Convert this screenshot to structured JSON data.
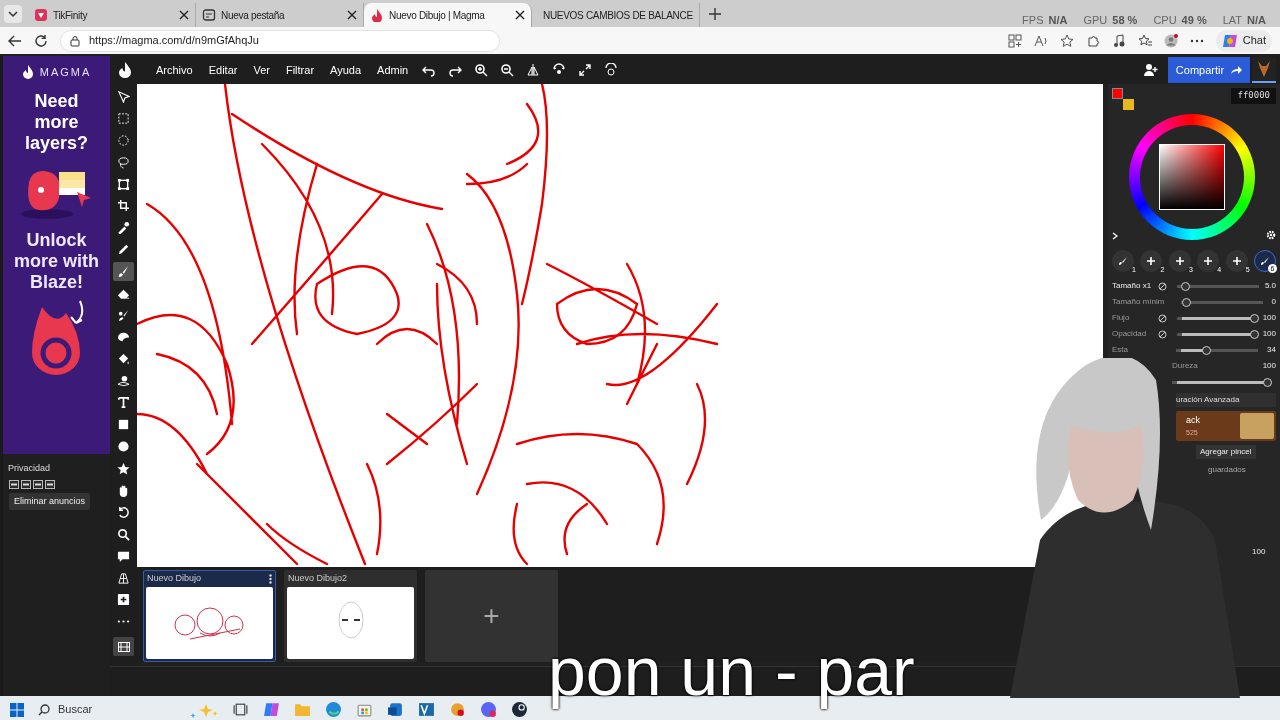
{
  "browser": {
    "tabs": [
      {
        "title": "TikFinity",
        "selected": false
      },
      {
        "title": "Nueva pestaña",
        "selected": false
      },
      {
        "title": "Nuevo Dibujo | Magma",
        "selected": true
      },
      {
        "title": "NUEVOS CAMBIOS DE BALANCE",
        "selected": false
      }
    ],
    "url": "https://magma.com/d/n9mGfAhqJu",
    "chat_button": "Chat"
  },
  "perf_overlay": [
    {
      "label": "FPS",
      "value": "N/A"
    },
    {
      "label": "GPU",
      "value": "58 %"
    },
    {
      "label": "CPU",
      "value": "49 %"
    },
    {
      "label": "LAT",
      "value": "N/A"
    }
  ],
  "ad": {
    "brand": "MAGMA",
    "headline": "Need more layers?",
    "tagline": "Unlock more with Blaze!",
    "privacy": "Privacidad",
    "remove_ads": "Eliminar anuncios"
  },
  "menu": [
    "Archivo",
    "Editar",
    "Ver",
    "Filtrar",
    "Ayuda",
    "Admin"
  ],
  "share_button": "Compartir",
  "tools": [
    {
      "kind": "move",
      "selected": false
    },
    {
      "kind": "rect-select",
      "selected": false
    },
    {
      "kind": "ellipse-select",
      "selected": false
    },
    {
      "kind": "lasso",
      "selected": false
    },
    {
      "kind": "transform",
      "selected": false
    },
    {
      "kind": "crop",
      "selected": false
    },
    {
      "kind": "eyedropper",
      "selected": false
    },
    {
      "kind": "pencil",
      "selected": false
    },
    {
      "kind": "brush",
      "selected": true
    },
    {
      "kind": "eraser",
      "selected": false
    },
    {
      "kind": "smudge",
      "selected": false
    },
    {
      "kind": "blur",
      "selected": false
    },
    {
      "kind": "fill",
      "selected": false
    },
    {
      "kind": "shape-brush",
      "selected": false
    },
    {
      "kind": "text",
      "selected": false
    },
    {
      "kind": "rect",
      "selected": false
    },
    {
      "kind": "ellipse",
      "selected": false
    },
    {
      "kind": "star",
      "selected": false
    },
    {
      "kind": "hand",
      "selected": false
    },
    {
      "kind": "rotate",
      "selected": false
    },
    {
      "kind": "zoom",
      "selected": false
    },
    {
      "kind": "comment",
      "selected": false
    },
    {
      "kind": "perspective",
      "selected": false
    },
    {
      "kind": "add",
      "selected": false
    },
    {
      "kind": "more",
      "selected": false
    }
  ],
  "color": {
    "hex": "ff0000"
  },
  "brush_slots": [
    {
      "label": "1",
      "kind": "brush",
      "selected": false
    },
    {
      "label": "2",
      "kind": "empty",
      "selected": false
    },
    {
      "label": "3",
      "kind": "empty",
      "selected": false
    },
    {
      "label": "4",
      "kind": "empty",
      "selected": false
    },
    {
      "label": "5",
      "kind": "empty",
      "selected": false
    },
    {
      "label": "6",
      "kind": "brush",
      "selected": true
    }
  ],
  "brush_settings": [
    {
      "label": "Tamaño x1",
      "pressure": true,
      "level": 0.05,
      "reading": "5.0"
    },
    {
      "label": "Tamaño mínim",
      "pressure": false,
      "level": 0,
      "reading": "0"
    },
    {
      "label": "Flujo",
      "pressure": true,
      "level": 1,
      "reading": "100"
    },
    {
      "label": "Opacidad",
      "pressure": true,
      "level": 1,
      "reading": "100"
    },
    {
      "label": "Esta",
      "pressure": false,
      "level": 0.34,
      "reading": "34"
    }
  ],
  "hardness": {
    "label": "Dureza",
    "reading": "100",
    "level": 1
  },
  "panel_fragments": {
    "advanced": "uración Avanzada",
    "promo_title": "ack",
    "promo_count": "525",
    "add_brush": "Agregar pincel",
    "saved": "guardados",
    "opacity_reading": "100"
  },
  "drawings": [
    {
      "title": "Nuevo Dibujo",
      "selected": true
    },
    {
      "title": "Nuevo Dibujo2",
      "selected": false
    }
  ],
  "add_drawing": "+",
  "subtitle": "pon un - par",
  "taskbar": {
    "search": "Buscar"
  }
}
